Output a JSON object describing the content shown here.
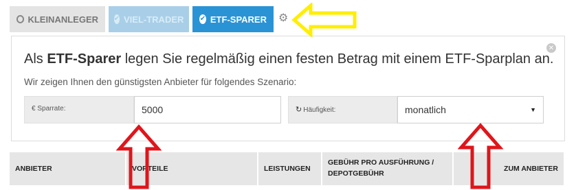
{
  "tabs": [
    {
      "label": "KLEINANLEGER"
    },
    {
      "label": "VIEL-TRADER"
    },
    {
      "label": "ETF-SPARER"
    }
  ],
  "headline": {
    "prefix": "Als ",
    "bold": "ETF-Sparer",
    "suffix": " legen Sie regelmäßig einen festen Betrag mit einem ETF-Sparplan an."
  },
  "subline": "Wir zeigen Ihnen den günstigsten Anbieter für folgendes Szenario:",
  "fields": {
    "sparrate": {
      "label": "€ Sparrate:",
      "value": "5000"
    },
    "haeufigkeit": {
      "label": "Häufigkeit:",
      "value": "monatlich"
    }
  },
  "table_headers": [
    "ANBIETER",
    "VORTEILE",
    "LEISTUNGEN",
    "GEBÜHR PRO AUSFÜHRUNG / DEPOTGEBÜHR",
    "ZUM ANBIETER"
  ],
  "colors": {
    "active_tab": "#2a93d5",
    "annotation_arrow_yellow": "#ffee00",
    "annotation_arrow_red": "#e0151b"
  },
  "icons": {
    "settings": "gear-icon",
    "close": "close-icon",
    "select": "caret-down-icon",
    "refresh": "refresh-icon"
  }
}
